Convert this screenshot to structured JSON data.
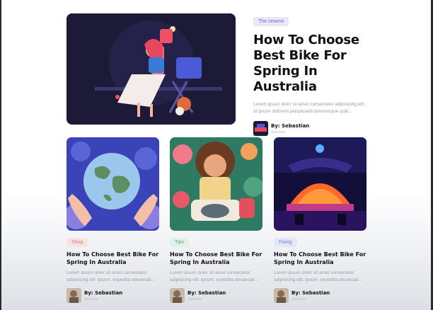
{
  "featured": {
    "badge": "The newest",
    "title": "How To Choose Best Bike For Spring In Australia",
    "excerpt": "Lorem ipsum dolor sit amet consectetur adipisicing elit. Id ipsum dolorem perspiciatis doloremque quib...",
    "author_name": "By: Sebastian",
    "author_meta": "Just now",
    "image_icon": "illustration-woman-at-sewing-machine"
  },
  "cards": [
    {
      "badge": "Shop",
      "title": "How To Choose Best Bike For Spring In Australia",
      "excerpt": "Lorem ipsum dolor sit amet consectetur adipisicing elit. Ipsum, expedita obcaecati...",
      "author_name": "By: Sebastian",
      "author_meta": "Just now",
      "image_icon": "illustration-hands-holding-globe"
    },
    {
      "badge": "Tips",
      "title": "How To Choose Best Bike For Spring In Australia",
      "excerpt": "Lorem ipsum dolor sit amet consectetur adipisicing elit. Ipsum, expedita obcaecati...",
      "author_name": "By: Sebastian",
      "author_meta": "Just now",
      "image_icon": "illustration-girl-with-cat"
    },
    {
      "badge": "Fixing",
      "title": "How To Choose Best Bike For Spring In Australia",
      "excerpt": "Lorem ipsum dolor sit amet consectetur adipisicing elit. Ipsum, expedita obcaecati...",
      "author_name": "By: Sebastian",
      "author_meta": "Just now",
      "image_icon": "illustration-neon-dome-building"
    }
  ],
  "colors": {
    "badge_newest": "#ece6fa",
    "badge_shop": "#fbe3e3",
    "badge_tips": "#e2f2ea",
    "badge_fixing": "#e4e7f7"
  }
}
